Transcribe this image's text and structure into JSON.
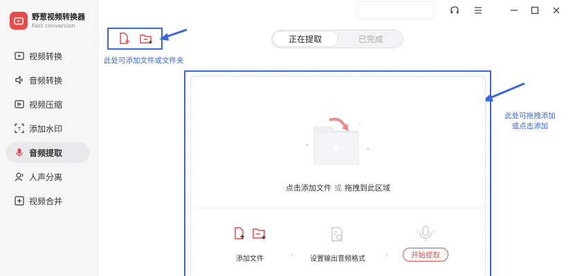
{
  "app": {
    "title": "野葱视频转换器",
    "subtitle": "Fast conversion"
  },
  "sidebar": {
    "items": [
      {
        "label": "视频转换",
        "icon": "video-convert-icon"
      },
      {
        "label": "音频转换",
        "icon": "audio-convert-icon"
      },
      {
        "label": "视频压缩",
        "icon": "video-compress-icon"
      },
      {
        "label": "添加水印",
        "icon": "watermark-icon"
      },
      {
        "label": "音频提取",
        "icon": "mic-icon",
        "active": true
      },
      {
        "label": "人声分离",
        "icon": "voice-separate-icon"
      },
      {
        "label": "视频合并",
        "icon": "video-merge-icon"
      }
    ]
  },
  "tabs": {
    "active": "正在提取",
    "done": "已完成"
  },
  "hints": {
    "add_here": "此处可添加文件或文件夹",
    "drag_line1": "此处可拖拽添加",
    "drag_line2": "或点击添加"
  },
  "drop": {
    "click_add": "点击添加文件",
    "or": "或",
    "drag_here": "拖拽到此区域"
  },
  "steps": {
    "add_file": "添加文件",
    "set_format": "设置输出音频格式",
    "start": "开始提取"
  },
  "colors": {
    "accent": "#e24a4a",
    "annotation": "#3a66e0"
  }
}
